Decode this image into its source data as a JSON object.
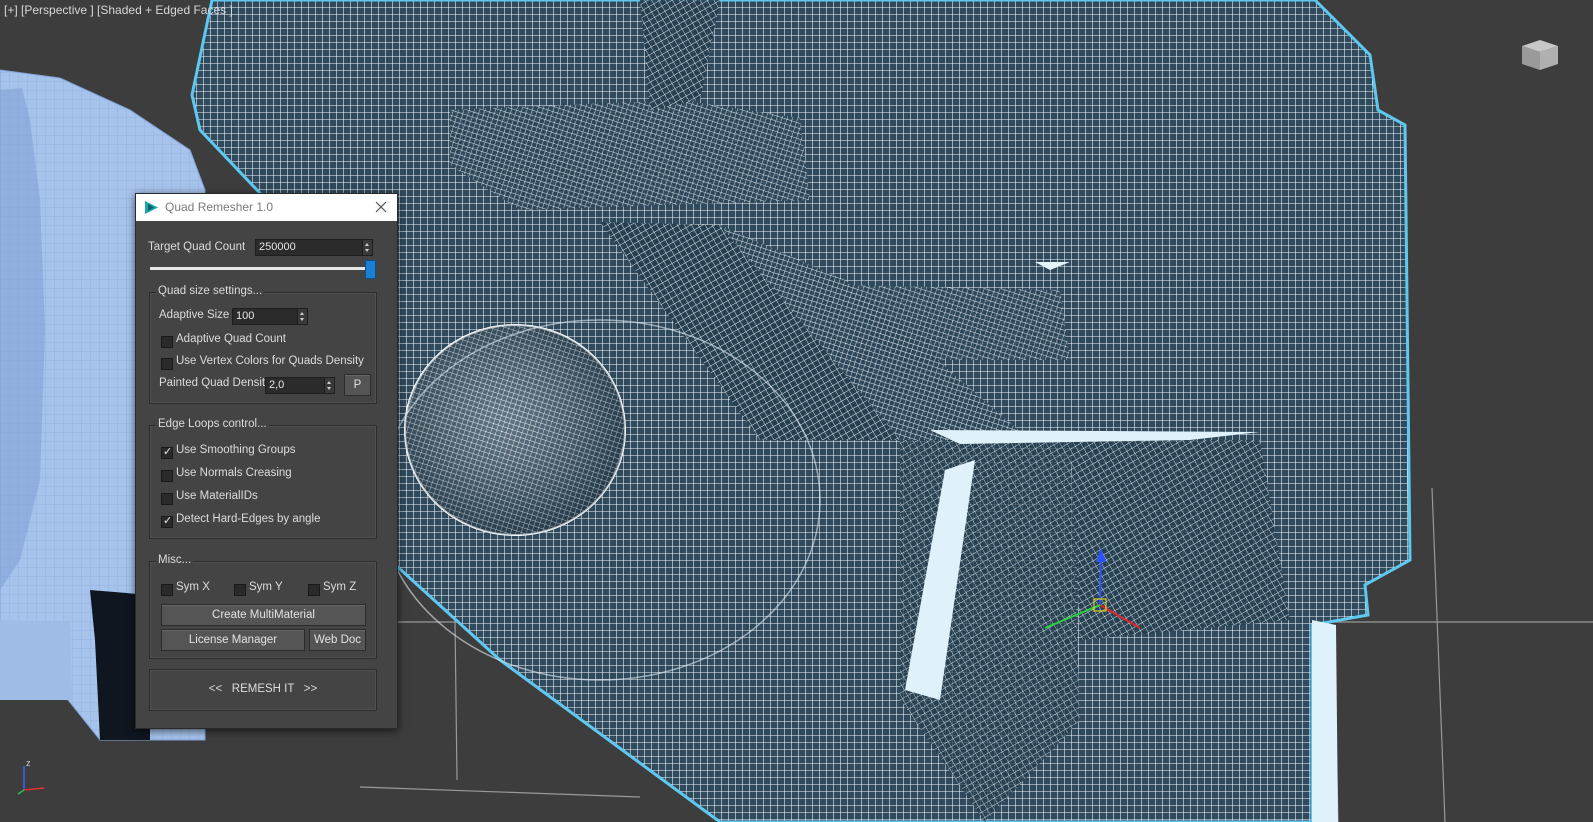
{
  "viewport": {
    "label": "[+] [Perspective ] [Shaded + Edged Faces ]",
    "viewcube_label": "",
    "axis_labels": {
      "x": "x",
      "y": "y",
      "z": "z"
    }
  },
  "dialog": {
    "title": "Quad Remesher 1.0",
    "target_quad_count_label": "Target Quad Count",
    "target_quad_count_value": "250000",
    "slider_level": 1.0,
    "quad_size": {
      "legend": "Quad size settings...",
      "adaptive_size_label": "Adaptive Size",
      "adaptive_size_value": "100",
      "adaptive_quad_count_label": "Adaptive Quad Count",
      "adaptive_quad_count_checked": false,
      "vertex_colors_label": "Use Vertex Colors for Quads Density",
      "vertex_colors_checked": false,
      "painted_density_label": "Painted Quad Density",
      "painted_density_value": "2,0",
      "p_button": "P"
    },
    "edge_loops": {
      "legend": "Edge Loops control...",
      "smoothing_groups_label": "Use Smoothing Groups",
      "smoothing_groups_checked": true,
      "normals_creasing_label": "Use Normals Creasing",
      "normals_creasing_checked": false,
      "material_ids_label": "Use MaterialIDs",
      "material_ids_checked": false,
      "hard_edges_label": "Detect Hard-Edges by angle",
      "hard_edges_checked": true
    },
    "misc": {
      "legend": "Misc...",
      "sym_x_label": "Sym X",
      "sym_y_label": "Sym Y",
      "sym_z_label": "Sym Z",
      "create_multimaterial": "Create MultiMaterial",
      "license_manager": "License Manager",
      "web_doc": "Web Doc"
    },
    "remesh_button": "<<   REMESH IT   >>"
  },
  "colors": {
    "viewport_bg": "#3d3d3d",
    "mesh_wire": "#ffffff",
    "mesh_outline": "#5ec8f0",
    "left_object": "#a9c6ee",
    "slider_thumb": "#1c7fd6"
  }
}
